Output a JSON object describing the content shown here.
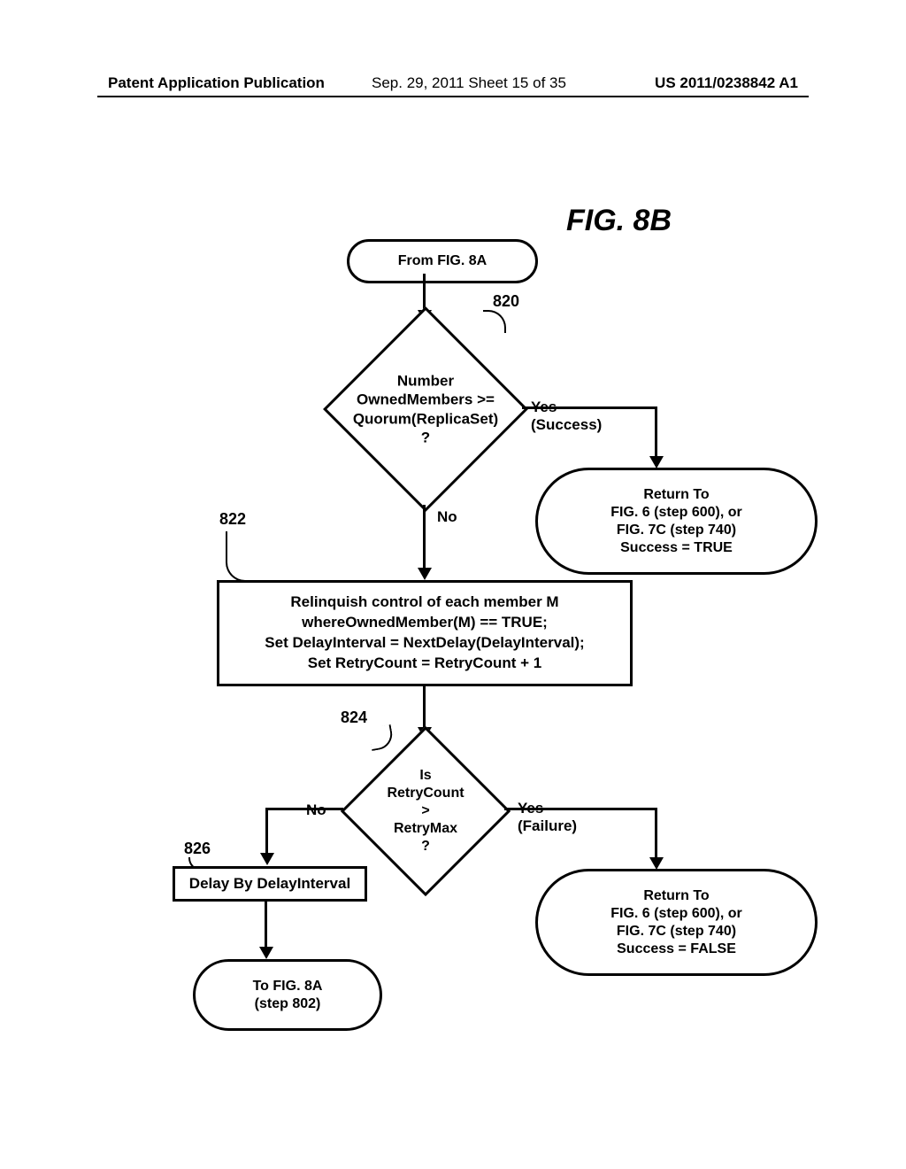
{
  "header": {
    "left": "Patent Application Publication",
    "center": "Sep. 29, 2011  Sheet 15 of 35",
    "right": "US 2011/0238842 A1"
  },
  "figure_title": "FIG. 8B",
  "terminals": {
    "from_8a": "From FIG. 8A",
    "to_8a": "To FIG. 8A\n(step 802)",
    "return_success": "Return To\nFIG. 6 (step 600), or\nFIG. 7C (step 740)\nSuccess = TRUE",
    "return_failure": "Return To\nFIG. 6 (step 600), or\nFIG. 7C (step 740)\nSuccess = FALSE"
  },
  "decisions": {
    "d820": "Number\nOwnedMembers >=\nQuorum(ReplicaSet)\n?",
    "d824": "Is\nRetryCount\n>\nRetryMax\n?"
  },
  "processes": {
    "p822": "Relinquish control of each member M\nwhereOwnedMember(M) == TRUE;\nSet DelayInterval = NextDelay(DelayInterval);\nSet RetryCount = RetryCount + 1",
    "p826": "Delay By DelayInterval"
  },
  "edge_labels": {
    "yes_success": "Yes\n(Success)",
    "no_820": "No",
    "no_824": "No",
    "yes_failure": "Yes\n(Failure)"
  },
  "refs": {
    "r820": "820",
    "r822": "822",
    "r824": "824",
    "r826": "826"
  }
}
